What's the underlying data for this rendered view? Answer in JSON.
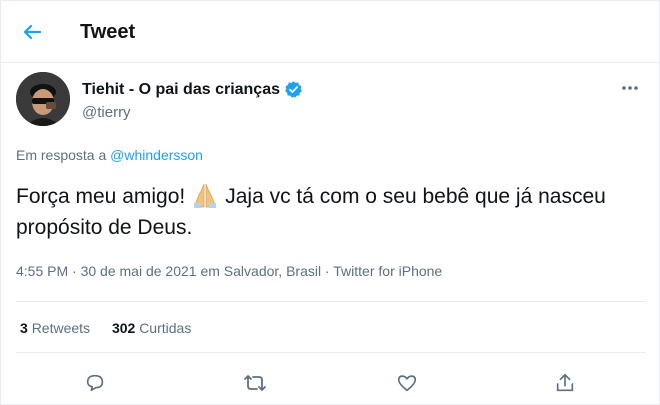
{
  "header": {
    "title": "Tweet",
    "back_icon": "arrow-left-icon"
  },
  "author": {
    "display_name": "Tiehit - O pai das crianças",
    "handle": "@tierry",
    "verified": true,
    "avatar_icon": "avatar"
  },
  "reply": {
    "prefix": "Em resposta a",
    "mention": "@whindersson"
  },
  "tweet": {
    "text_part1": "Força meu amigo!",
    "emoji": "folded-hands-emoji",
    "text_part2": "Jaja vc tá com o seu bebê que já nasceu propósito de Deus."
  },
  "meta": {
    "time": "4:55 PM",
    "date": "30 de mai de 2021",
    "location": "em Salvador, Brasil",
    "source": "Twitter for iPhone",
    "separator": "·"
  },
  "stats": {
    "retweets_count": "3",
    "retweets_label": "Retweets",
    "likes_count": "302",
    "likes_label": "Curtidas"
  },
  "actions": [
    "reply-icon",
    "retweet-icon",
    "like-icon",
    "share-icon"
  ],
  "colors": {
    "accent": "#1da1f2",
    "text": "#0f1419",
    "secondary": "#5b7083",
    "border": "#e6ecf0"
  }
}
